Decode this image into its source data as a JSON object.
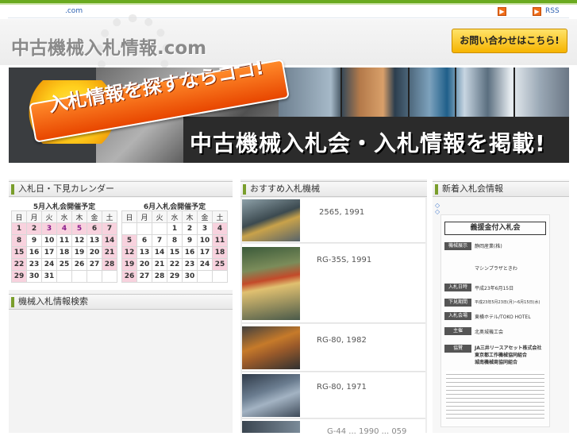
{
  "topbar": {
    "domain_label": ".com",
    "rss_label": "RSS"
  },
  "header": {
    "logo_text": "中古機械入札情報.com",
    "contact_button": "お問い合わせはこちら!"
  },
  "banner": {
    "ribbon_text": "入札情報を探すならココ!",
    "headline": "中古機械入札会・入札情報を掲載!"
  },
  "calendar_panel": {
    "title": "入札日・下見カレンダー",
    "weekdays": [
      "日",
      "月",
      "火",
      "水",
      "木",
      "金",
      "土"
    ],
    "months": [
      {
        "title": "5月入札会開催予定",
        "weeks": [
          [
            "1",
            "2",
            "3",
            "4",
            "5",
            "6",
            "7"
          ],
          [
            "8",
            "9",
            "10",
            "11",
            "12",
            "13",
            "14"
          ],
          [
            "15",
            "16",
            "17",
            "18",
            "19",
            "20",
            "21"
          ],
          [
            "22",
            "23",
            "24",
            "25",
            "26",
            "27",
            "28"
          ],
          [
            "29",
            "30",
            "31",
            "",
            "",
            "",
            ""
          ]
        ]
      },
      {
        "title": "6月入札会開催予定",
        "weeks": [
          [
            "",
            "",
            "",
            "1",
            "2",
            "3",
            "4"
          ],
          [
            "5",
            "6",
            "7",
            "8",
            "9",
            "10",
            "11"
          ],
          [
            "12",
            "13",
            "14",
            "15",
            "16",
            "17",
            "18"
          ],
          [
            "19",
            "20",
            "21",
            "22",
            "23",
            "24",
            "25"
          ],
          [
            "26",
            "27",
            "28",
            "29",
            "30",
            "",
            ""
          ]
        ]
      }
    ]
  },
  "search_panel": {
    "title": "機械入札情報検索"
  },
  "recommended_panel": {
    "title": "おすすめ入札機械",
    "items": [
      {
        "text": "2565, 1991"
      },
      {
        "text": "RG-35S, 1991"
      },
      {
        "text": "RG-80, 1982"
      },
      {
        "text": "RG-80, 1971"
      },
      {
        "text": "G-44 ... 1990 ... 059"
      }
    ]
  },
  "news_panel": {
    "title": "新着入札会情報",
    "marker": "◇",
    "notice": {
      "heading": "義援金付入札会",
      "labels": [
        "機械展示",
        "入札日時",
        "下見期間",
        "入札会場",
        "主催",
        "協賛"
      ],
      "lines": [
        "静岡産業(株)",
        "マシンプラザときわ",
        "平成23年6月15日",
        "平成23年5月23日(月)~6月15日(水)",
        "東横ホテル/TOKO HOTEL",
        "北奥城機工会",
        "JA三井リースアセット株式会社",
        "東京都工作機械協同組合",
        "城南機械商協同組合"
      ]
    }
  }
}
